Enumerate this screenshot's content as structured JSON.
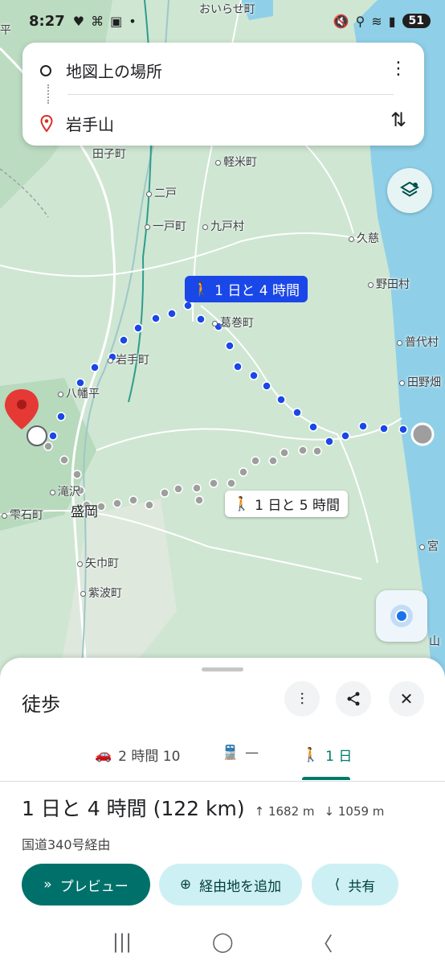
{
  "status_bar": {
    "time": "8:27",
    "left_icons": [
      "heart-icon",
      "game-icon",
      "screenshot-icon",
      "dot-icon"
    ],
    "right_icons": [
      "mute-icon",
      "location-icon",
      "wifi-icon",
      "signal-icon"
    ],
    "battery": "51"
  },
  "search": {
    "origin": "地図上の場所",
    "destination": "岩手山",
    "more_icon": "more-vert-icon",
    "swap_icon": "swap-vert-icon"
  },
  "map": {
    "places": [
      {
        "name": "おいらせ町",
        "big": false
      },
      {
        "name": "田子町",
        "big": false
      },
      {
        "name": "軽米町",
        "big": false
      },
      {
        "name": "二戸",
        "big": false
      },
      {
        "name": "一戸町",
        "big": false
      },
      {
        "name": "九戸村",
        "big": false
      },
      {
        "name": "久慈",
        "big": false
      },
      {
        "name": "野田村",
        "big": false
      },
      {
        "name": "葛巻町",
        "big": false
      },
      {
        "name": "普代村",
        "big": false
      },
      {
        "name": "岩手町",
        "big": false
      },
      {
        "name": "田野畑",
        "big": false
      },
      {
        "name": "八幡平",
        "big": false
      },
      {
        "name": "滝沢",
        "big": false
      },
      {
        "name": "盛岡",
        "big": true
      },
      {
        "name": "雫石町",
        "big": false
      },
      {
        "name": "矢巾町",
        "big": false
      },
      {
        "name": "紫波町",
        "big": false
      },
      {
        "name": "宮",
        "big": false
      },
      {
        "name": "山",
        "big": false
      },
      {
        "name": "平",
        "big": false
      }
    ],
    "route_primary_label": "1 日と 4 時間",
    "route_alt_label": "1 日と 5 時間",
    "colors": {
      "primary_route": "#1a47e8",
      "alt_route": "#9e9e9e",
      "destination_pin": "#e53935"
    }
  },
  "sheet": {
    "title": "徒歩",
    "tabs": [
      {
        "icon": "car-icon",
        "label": "2 時間 10"
      },
      {
        "icon": "train-icon",
        "label": "—"
      },
      {
        "icon": "walk-icon",
        "label": "1 日"
      }
    ],
    "active_tab": 2,
    "duration": "1 日と 4 時間 (122 km)",
    "ascent": "1682 m",
    "descent": "1059 m",
    "via": "国道340号経由",
    "buttons": {
      "preview": "プレビュー",
      "add_stop": "経由地を追加",
      "share": "共有"
    },
    "accent": "#00716a"
  },
  "navbar": {
    "recent": "|||",
    "home": "◯",
    "back": "〈"
  }
}
